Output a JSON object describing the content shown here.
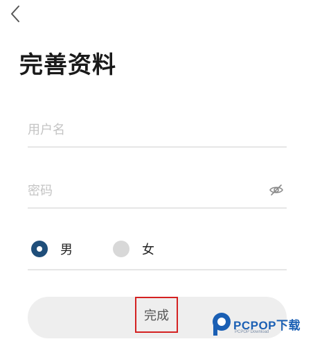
{
  "header": {
    "back_icon": "chevron-left-icon"
  },
  "title": "完善资料",
  "form": {
    "username": {
      "placeholder": "用户名",
      "value": ""
    },
    "password": {
      "placeholder": "密码",
      "value": "",
      "toggle_icon": "eye-off-icon"
    },
    "gender": {
      "options": [
        {
          "label": "男",
          "selected": true
        },
        {
          "label": "女",
          "selected": false
        }
      ]
    }
  },
  "submit": {
    "label": "完成"
  },
  "watermark": {
    "brand": "PCPOP下载",
    "sub": "PCPOP Download"
  },
  "colors": {
    "radio_checked": "#1f4e7a",
    "radio_unchecked": "#d8d8d8",
    "highlight_box": "#d42020",
    "watermark": "#1a5fb4"
  }
}
